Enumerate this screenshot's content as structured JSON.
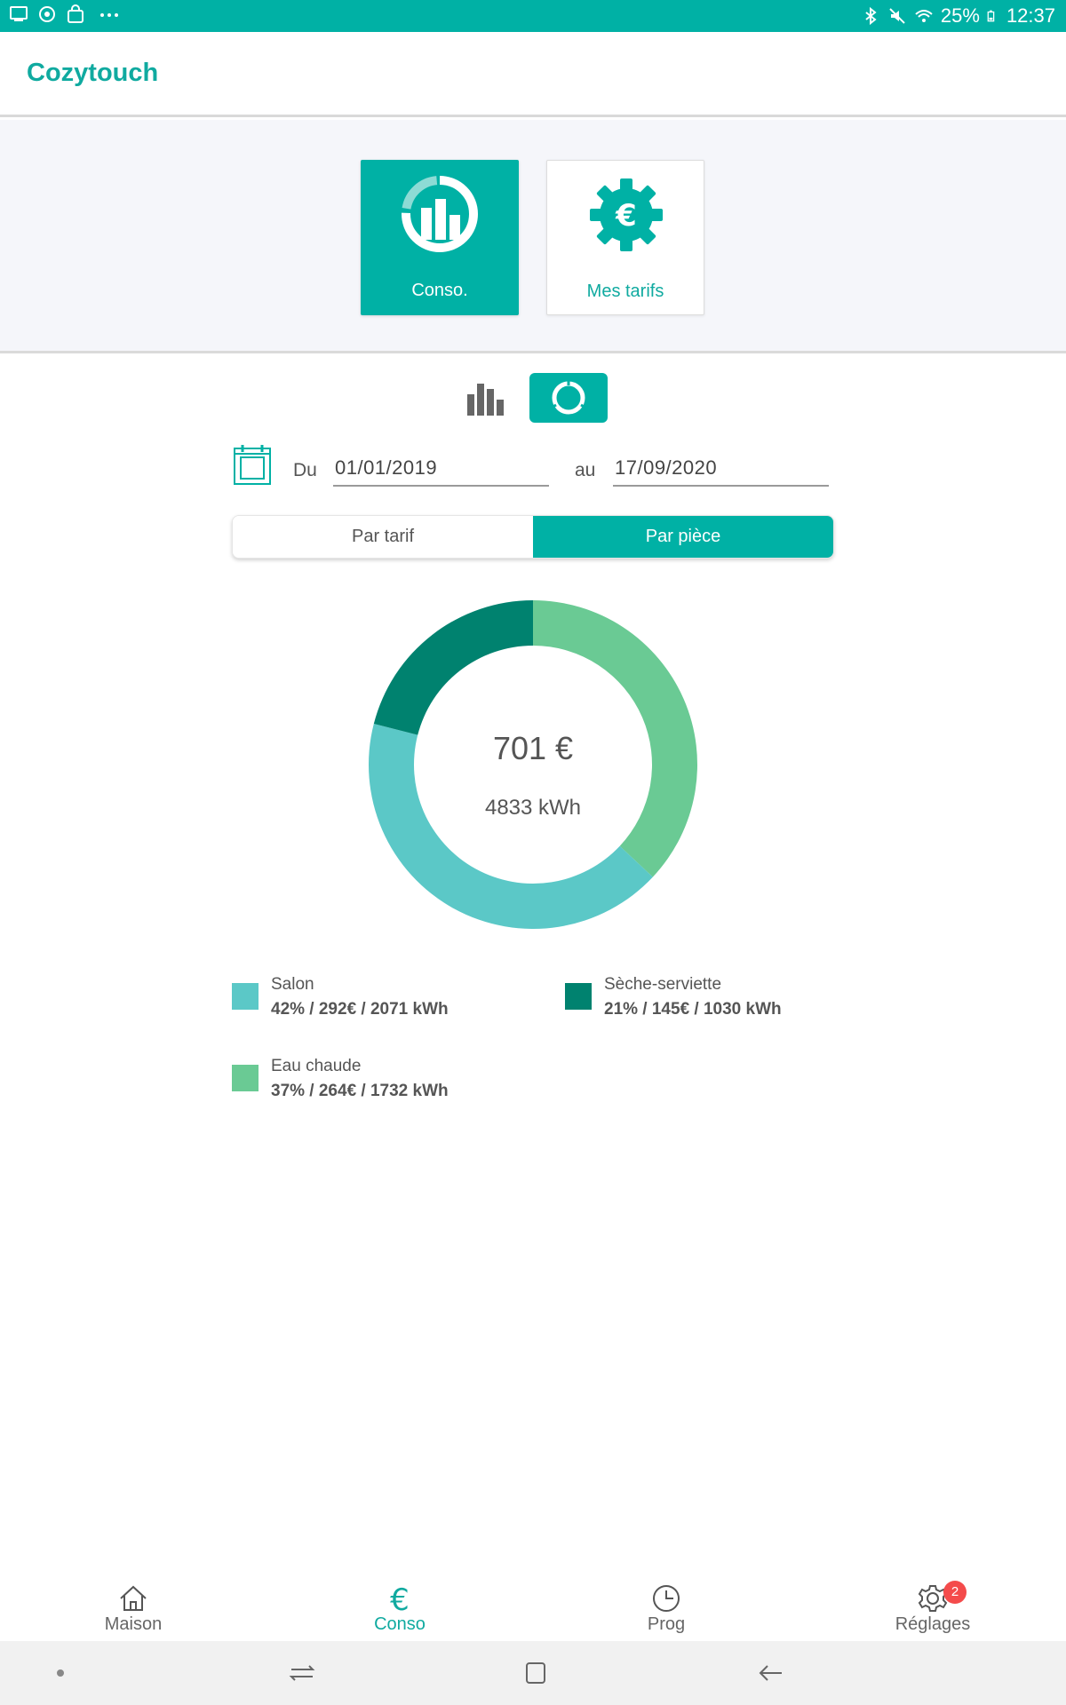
{
  "statusbar": {
    "battery": "25%",
    "time": "12:37",
    "icons": [
      "screen-icon",
      "sync-icon",
      "bag-icon",
      "more-icon",
      "bluetooth-icon",
      "mute-icon",
      "wifi-icon",
      "battery-icon"
    ]
  },
  "app": {
    "title": "Cozytouch"
  },
  "cards": {
    "conso": {
      "label": "Conso.",
      "icon": "donut-bars-icon"
    },
    "tarifs": {
      "label": "Mes tarifs",
      "icon": "euro-gear-icon"
    }
  },
  "view_toggle": {
    "active": "donut"
  },
  "dates": {
    "from_label": "Du",
    "from_value": "01/01/2019",
    "to_label": "au",
    "to_value": "17/09/2020"
  },
  "segmented": {
    "tarif_label": "Par tarif",
    "piece_label": "Par pièce",
    "active": "piece"
  },
  "chart_data": {
    "type": "pie",
    "center_value": "701 €",
    "center_sub": "4833 kWh",
    "series": [
      {
        "name": "Salon",
        "percent": 42,
        "color": "#5bc8c7"
      },
      {
        "name": "Sèche-serviette",
        "percent": 21,
        "color": "#00826f"
      },
      {
        "name": "Eau chaude",
        "percent": 37,
        "color": "#6aca94"
      }
    ]
  },
  "legend": [
    {
      "name": "Salon",
      "values": "42% / 292€ / 2071 kWh",
      "color": "#5bc8c7"
    },
    {
      "name": "Sèche-serviette",
      "values": "21% / 145€ / 1030 kWh",
      "color": "#00826f"
    },
    {
      "name": "Eau chaude",
      "values": "37% / 264€ / 1732 kWh",
      "color": "#6aca94"
    }
  ],
  "bottom_nav": {
    "items": [
      {
        "label": "Maison",
        "icon": "home-icon"
      },
      {
        "label": "Conso",
        "icon": "euro-icon"
      },
      {
        "label": "Prog",
        "icon": "clock-icon"
      },
      {
        "label": "Réglages",
        "icon": "gear-icon",
        "badge": "2"
      }
    ],
    "active": "Conso"
  },
  "colors": {
    "accent": "#00b1a5",
    "accent_text": "#10aaa0",
    "badge": "#f44b4b"
  }
}
